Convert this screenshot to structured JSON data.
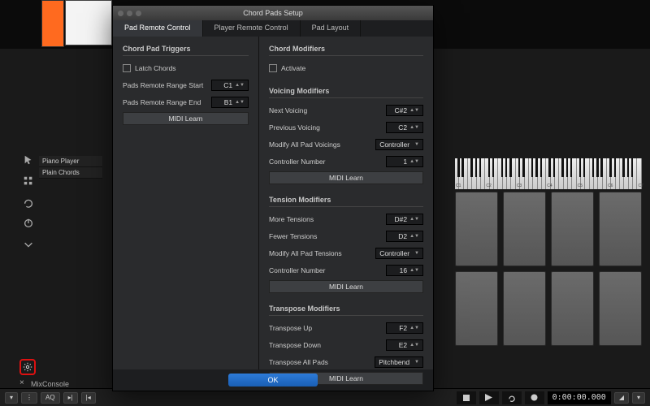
{
  "dialog": {
    "title": "Chord Pads Setup",
    "tabs": [
      "Pad Remote Control",
      "Player Remote Control",
      "Pad Layout"
    ],
    "active_tab": 0,
    "ok_label": "OK"
  },
  "left_col": {
    "triggers_header": "Chord Pad Triggers",
    "latch_label": "Latch Chords",
    "range_start_label": "Pads Remote Range Start",
    "range_start_value": "C1",
    "range_end_label": "Pads Remote Range End",
    "range_end_value": "B1",
    "midi_learn": "MIDI Learn"
  },
  "chord_modifiers": {
    "header": "Chord Modifiers",
    "activate_label": "Activate"
  },
  "voicing": {
    "header": "Voicing Modifiers",
    "next_label": "Next Voicing",
    "next_value": "C#2",
    "prev_label": "Previous Voicing",
    "prev_value": "C2",
    "all_label": "Modify All Pad Voicings",
    "all_value": "Controller",
    "ctrl_label": "Controller Number",
    "ctrl_value": "1",
    "midi_learn": "MIDI Learn"
  },
  "tension": {
    "header": "Tension Modifiers",
    "more_label": "More Tensions",
    "more_value": "D#2",
    "fewer_label": "Fewer Tensions",
    "fewer_value": "D2",
    "all_label": "Modify All Pad Tensions",
    "all_value": "Controller",
    "ctrl_label": "Controller Number",
    "ctrl_value": "16",
    "midi_learn": "MIDI Learn"
  },
  "transpose": {
    "header": "Transpose Modifiers",
    "up_label": "Transpose Up",
    "up_value": "F2",
    "down_label": "Transpose Down",
    "down_value": "E2",
    "all_label": "Transpose All Pads",
    "all_value": "Pitchbend",
    "midi_learn": "MIDI Learn"
  },
  "sidebar": {
    "items": [
      "Piano Player",
      "Plain Chords"
    ]
  },
  "keyboard_labels": [
    "C1",
    "C2",
    "C3",
    "C4",
    "C5",
    "C6",
    "C7"
  ],
  "bottom": {
    "mixconsole": "MixConsole",
    "aq": "AQ",
    "timecode": "0:00:00.000"
  }
}
